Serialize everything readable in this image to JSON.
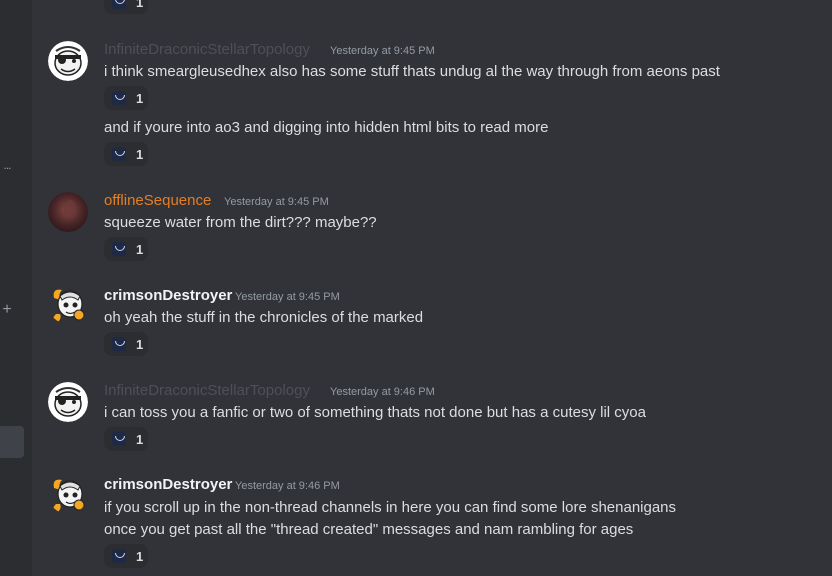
{
  "colors": {
    "background": "#313338",
    "sidebar": "#2b2d31",
    "text": "#dbdee1",
    "muted": "#949ba4",
    "user_faded": "#4e5058",
    "user_orange": "#e67e22",
    "user_white": "#f2f3f5"
  },
  "sidebar": {
    "dots": "...",
    "plus": "+"
  },
  "top_reaction": {
    "icon": "smile-emoji-icon",
    "count": "1"
  },
  "messages": [
    {
      "username": "InfiniteDraconicStellarTopology",
      "timestamp": "Yesterday at 9:45 PM",
      "avatar": "skull-eyepatch-avatar",
      "lines": [
        "i think smeargleusedhex also has some stuff thats undug al the way through from aeons past"
      ],
      "reaction_count": "1",
      "followup": {
        "text": "and if youre into ao3 and digging into hidden html bits to read more",
        "reaction_count": "1"
      }
    },
    {
      "username": "offlineSequence",
      "timestamp": "Yesterday at 9:45 PM",
      "avatar": "dark-red-avatar",
      "lines": [
        "squeeze water from the dirt??? maybe??"
      ],
      "reaction_count": "1"
    },
    {
      "username": "crimsonDestroyer",
      "timestamp": "Yesterday at 9:45 PM",
      "avatar": "orange-character-avatar",
      "lines": [
        "oh yeah the stuff in the chronicles of the marked"
      ],
      "reaction_count": "1"
    },
    {
      "username": "InfiniteDraconicStellarTopology",
      "timestamp": "Yesterday at 9:46 PM",
      "avatar": "skull-eyepatch-avatar",
      "lines": [
        "i can toss you a fanfic or two of something thats not done but has a cutesy lil cyoa"
      ],
      "reaction_count": "1"
    },
    {
      "username": "crimsonDestroyer",
      "timestamp": "Yesterday at 9:46 PM",
      "avatar": "orange-character-avatar",
      "lines": [
        "if you scroll up in the non-thread channels in here you can find some lore shenanigans",
        "once you get past all the \"thread created\" messages and nam rambling for ages"
      ],
      "reaction_count": "1"
    }
  ]
}
